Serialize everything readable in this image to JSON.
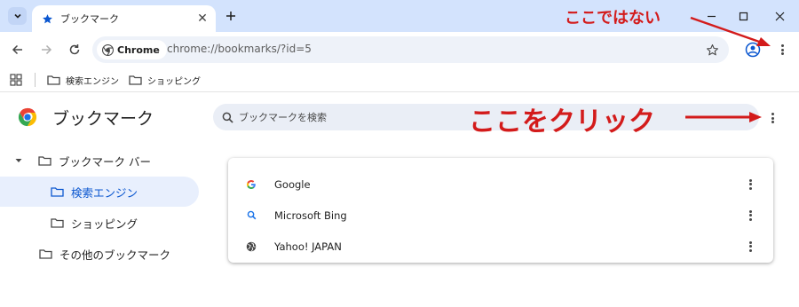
{
  "browser": {
    "tab": {
      "title": "ブックマーク",
      "close_label": "✕"
    },
    "new_tab_label": "+",
    "window_controls": {
      "minimize": "—",
      "maximize": "☐",
      "close": "✕"
    },
    "omnibox": {
      "chip_label": "Chrome",
      "url": "chrome://bookmarks/?id=5"
    },
    "bookmarks_bar": {
      "items": [
        {
          "label": "検索エンジン",
          "icon": "folder-icon"
        },
        {
          "label": "ショッピング",
          "icon": "folder-icon"
        }
      ]
    }
  },
  "page": {
    "title": "ブックマーク",
    "search_placeholder": "ブックマークを検索"
  },
  "sidebar": {
    "items": [
      {
        "label": "ブックマーク バー",
        "expanded": true,
        "level": 0
      },
      {
        "label": "検索エンジン",
        "selected": true,
        "level": 1
      },
      {
        "label": "ショッピング",
        "level": 1
      },
      {
        "label": "その他のブックマーク",
        "level": 0
      }
    ]
  },
  "bookmarks": [
    {
      "title": "Google",
      "icon": "google-favicon"
    },
    {
      "title": "Microsoft Bing",
      "icon": "search-favicon"
    },
    {
      "title": "Yahoo! JAPAN",
      "icon": "globe-icon"
    }
  ],
  "annotations": {
    "not_here": "ここではない",
    "click_here": "ここをクリック"
  },
  "colors": {
    "tabstrip": "#d3e3fd",
    "accent": "#0b57d0",
    "selected_bg": "#e8effd",
    "annotation_red": "#d31b1b"
  }
}
